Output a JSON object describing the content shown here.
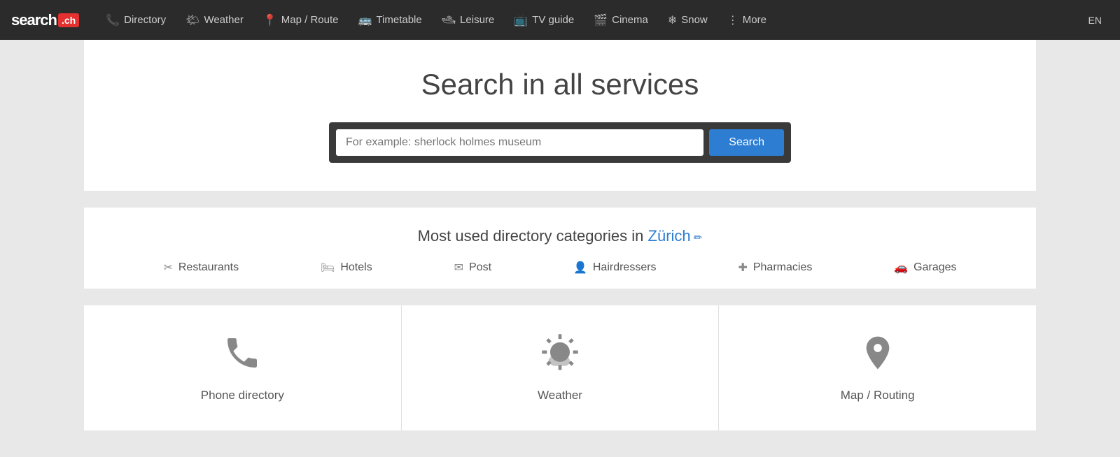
{
  "logo": {
    "text": "search",
    "box": ".ch"
  },
  "nav": {
    "items": [
      {
        "id": "directory",
        "label": "Directory",
        "icon": "📞"
      },
      {
        "id": "weather",
        "label": "Weather",
        "icon": "🌤"
      },
      {
        "id": "map-route",
        "label": "Map / Route",
        "icon": "📍"
      },
      {
        "id": "timetable",
        "label": "Timetable",
        "icon": "🚌"
      },
      {
        "id": "leisure",
        "label": "Leisure",
        "icon": "🛥"
      },
      {
        "id": "tv-guide",
        "label": "TV guide",
        "icon": "📺"
      },
      {
        "id": "cinema",
        "label": "Cinema",
        "icon": "🎬"
      },
      {
        "id": "snow",
        "label": "Snow",
        "icon": "❄"
      },
      {
        "id": "more",
        "label": "More",
        "icon": "⋮"
      }
    ],
    "lang": "EN"
  },
  "search": {
    "title": "Search in all services",
    "placeholder": "For example: sherlock holmes museum",
    "button_label": "Search"
  },
  "directory": {
    "heading_prefix": "Most used directory categories in ",
    "city": "Zürich",
    "categories": [
      {
        "id": "restaurants",
        "icon": "✂",
        "label": "Restaurants"
      },
      {
        "id": "hotels",
        "icon": "🛏",
        "label": "Hotels"
      },
      {
        "id": "post",
        "icon": "✉",
        "label": "Post"
      },
      {
        "id": "hairdressers",
        "icon": "👤",
        "label": "Hairdressers"
      },
      {
        "id": "pharmacies",
        "icon": "✚",
        "label": "Pharmacies"
      },
      {
        "id": "garages",
        "icon": "🚗",
        "label": "Garages"
      }
    ]
  },
  "service_cards": [
    {
      "id": "phone-directory",
      "label": "Phone directory",
      "icon_type": "phone"
    },
    {
      "id": "weather",
      "label": "Weather",
      "icon_type": "weather"
    },
    {
      "id": "map-routing",
      "label": "Map / Routing",
      "icon_type": "map"
    }
  ]
}
